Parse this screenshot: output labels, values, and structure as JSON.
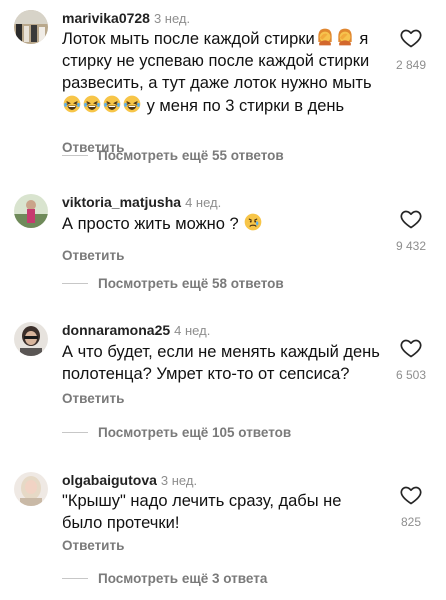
{
  "comments": [
    {
      "username": "marivika0728",
      "age": "3 нед.",
      "lines": [
        "Лоток мыть после каждой стирки",
        " я",
        "стирку не успеваю после каждой стирки",
        "развесить, а тут даже лоток нужно мыть",
        " у меня по 3 стирки в день"
      ],
      "likes": "2 849",
      "reply_label": "Ответить",
      "more_replies": "Посмотреть ещё 55 ответов",
      "avatar_color": "#b9a88c"
    },
    {
      "username": "viktoria_matjusha",
      "age": "4 нед.",
      "lines": [
        "А просто жить можно ?"
      ],
      "likes": "9 432",
      "reply_label": "Ответить",
      "more_replies": "Посмотреть ещё 58 ответов",
      "avatar_color": "#6f8a5a"
    },
    {
      "username": "donnaramona25",
      "age": "4 нед.",
      "lines": [
        "А что будет, если не менять каждый день",
        "полотенца? Умрет кто-то от сепсиса?"
      ],
      "likes": "6 503",
      "reply_label": "Ответить",
      "more_replies": "Посмотреть ещё 105 ответов",
      "avatar_color": "#6d6a66"
    },
    {
      "username": "olgabaigutova",
      "age": "3 нед.",
      "lines": [
        "\"Крышу\" надо лечить сразу, дабы не",
        "было протечки!"
      ],
      "likes": "825",
      "reply_label": "Ответить",
      "more_replies": "Посмотреть ещё 3 ответа",
      "avatar_color": "#c9b9a6"
    }
  ],
  "icons": {
    "like": "heart-outline-icon",
    "facepalm": "woman-facepalming-emoji",
    "laugh": "rolling-on-floor-laughing-emoji",
    "sad": "crying-face-emoji"
  },
  "colors": {
    "secondary_text": "#8e8e8e",
    "primary_text": "#111111"
  }
}
